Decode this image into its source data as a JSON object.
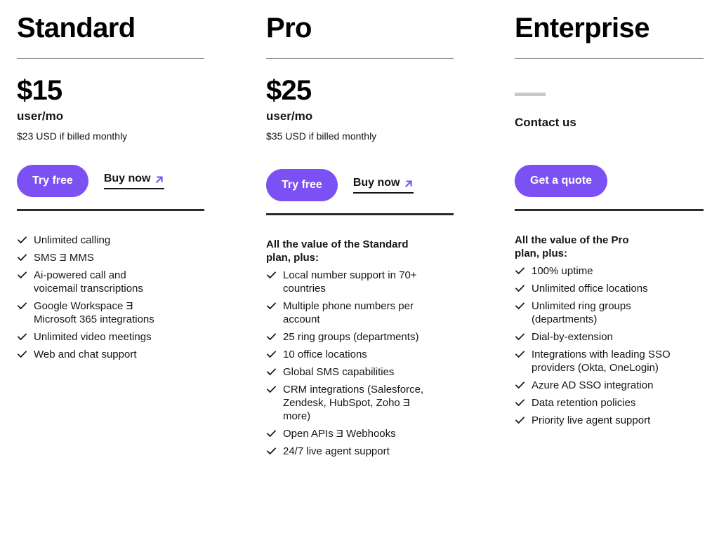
{
  "brand": {
    "accent_purple": "#7b51f4",
    "text_color": "#15141a",
    "rule_light": "#8d8d8d",
    "rule_dark": "#2b2b2b",
    "dash_gray": "#c8c8c8"
  },
  "plans": [
    {
      "id": "standard",
      "title": "Standard",
      "price": "$15",
      "unit": "user/mo",
      "note": "$23 USD if billed monthly",
      "primary_cta": "Try free",
      "secondary_cta": "Buy now",
      "features_intro": "",
      "features": [
        "Unlimited calling",
        "SMS Ǝ MMS",
        "Ai-powered call and voicemail transcriptions",
        "Google Workspace Ǝ Microsoft 365 integrations",
        "Unlimited video meetings",
        "Web and chat support"
      ]
    },
    {
      "id": "pro",
      "title": "Pro",
      "price": "$25",
      "unit": "user/mo",
      "note": "$35 USD if billed monthly",
      "primary_cta": "Try free",
      "secondary_cta": "Buy now",
      "features_intro": "All the value of the Standard plan, plus:",
      "features": [
        "Local number support in 70+ countries",
        "Multiple phone numbers per account",
        "25 ring groups (departments)",
        "10 office locations",
        "Global SMS capabilities",
        "CRM integrations (Salesforce, Zendesk, HubSpot, Zoho Ǝ more)",
        "Open APIs Ǝ Webhooks",
        "24/7 live agent support"
      ]
    },
    {
      "id": "enterprise",
      "title": "Enterprise",
      "price": "",
      "unit": "",
      "note": "",
      "contact_label": "Contact us",
      "primary_cta": "Get a quote",
      "secondary_cta": "",
      "features_intro": "All the value of the Pro plan, plus:",
      "features": [
        "100% uptime",
        "Unlimited office locations",
        "Unlimited ring groups (departments)",
        "Dial-by-extension",
        "Integrations with leading SSO providers (Okta, OneLogin)",
        "Azure AD SSO integration",
        "Data retention policies",
        "Priority live agent support"
      ]
    }
  ],
  "icons": {
    "check": "✓",
    "external_arrow": "arrow-up-right"
  }
}
